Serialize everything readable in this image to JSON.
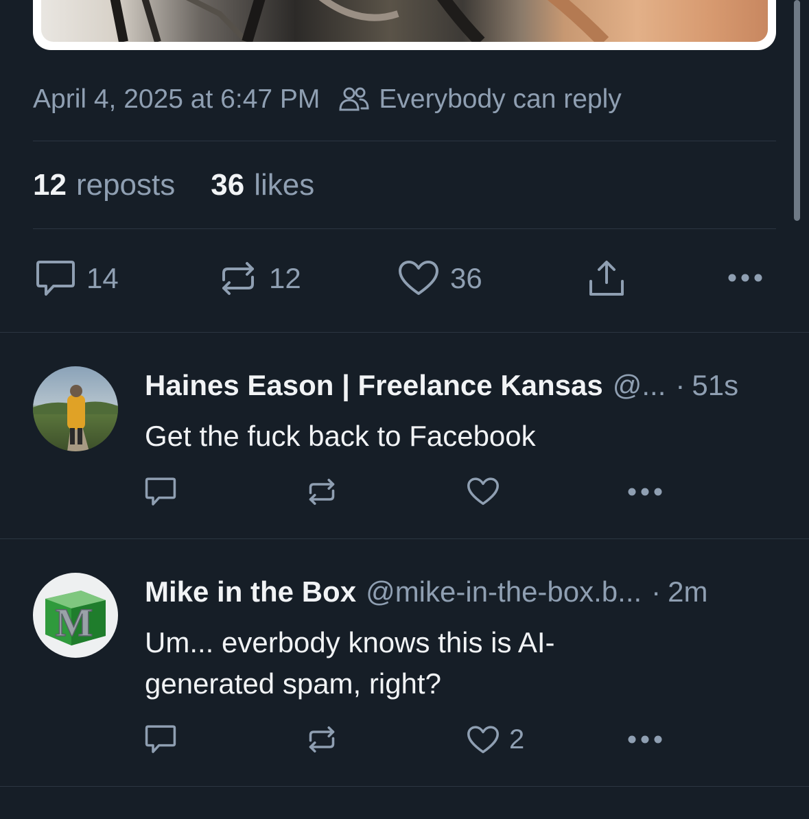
{
  "post": {
    "timestamp": "April 4, 2025 at 6:47 PM",
    "reply_setting": "Everybody can reply",
    "stats": {
      "reposts_count": "12",
      "reposts_label": "reposts",
      "likes_count": "36",
      "likes_label": "likes"
    },
    "actions": {
      "reply_count": "14",
      "repost_count": "12",
      "like_count": "36"
    }
  },
  "replies": [
    {
      "name": "Haines Eason | Freelance Kansas",
      "handle": "@...",
      "separator": "·",
      "time": "51s",
      "text": "Get the fuck back to Facebook",
      "like_count": ""
    },
    {
      "name": "Mike in the Box",
      "handle": "@mike-in-the-box.b...",
      "separator": "·",
      "time": "2m",
      "text": "Um... everbody knows this is AI-generated spam, right?",
      "like_count": "2"
    }
  ],
  "icons": {
    "reply": "speech-bubble-icon",
    "repost": "repost-arrows-icon",
    "like": "heart-icon",
    "share": "share-upload-icon",
    "more": "ellipsis-icon",
    "reply_setting": "people-icon"
  },
  "colors": {
    "background": "#161e27",
    "text_primary": "#f1f3f5",
    "text_secondary": "#8f9fb2",
    "divider": "#2c3642"
  }
}
